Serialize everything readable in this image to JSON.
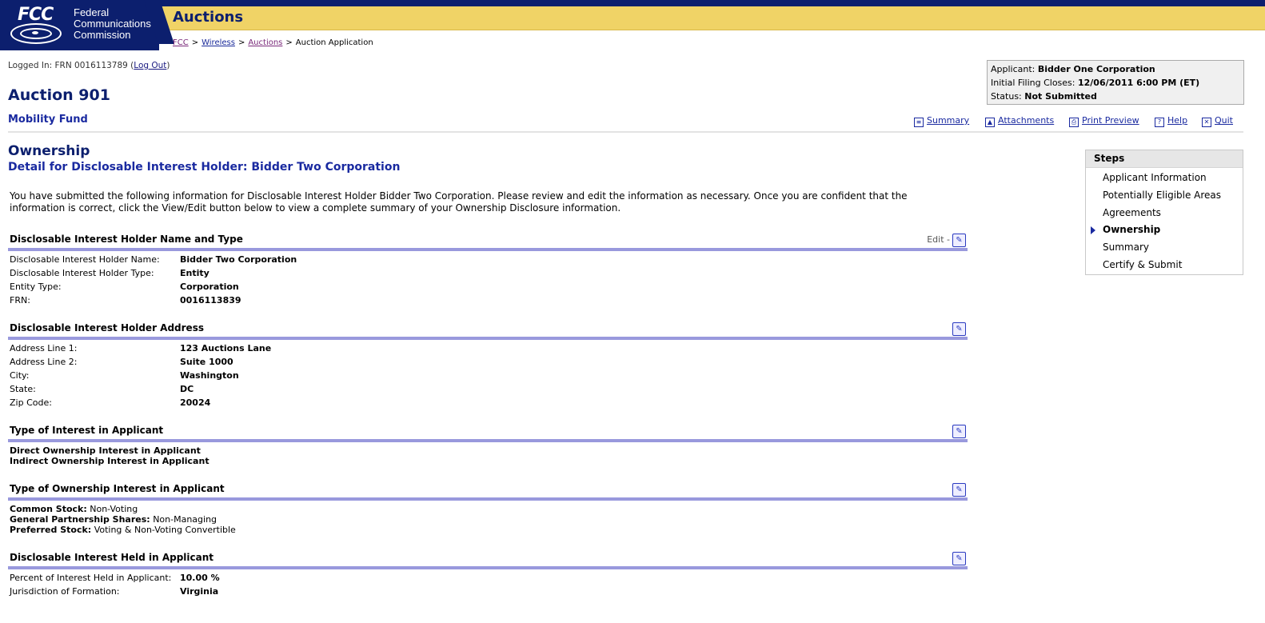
{
  "header": {
    "logo_text": "FCC",
    "agency_name": [
      "Federal",
      "Communications",
      "Commission"
    ],
    "app_title": "Auctions",
    "breadcrumb": [
      {
        "label": "FCC",
        "link": true
      },
      {
        "label": "Wireless",
        "link": true
      },
      {
        "label": "Auctions",
        "link": true
      },
      {
        "label": "Auction Application",
        "link": false
      }
    ]
  },
  "session": {
    "logged_in_prefix": "Logged In: FRN 0016113789 (",
    "logout_label": "Log Out",
    "logged_in_suffix": ")"
  },
  "auction": {
    "title": "Auction 901",
    "subtitle": "Mobility Fund"
  },
  "applicant_box": {
    "applicant_label": "Applicant:",
    "applicant_value": "Bidder One Corporation",
    "filing_label": "Initial Filing Closes:",
    "filing_value": "12/06/2011 6:00 PM (ET)",
    "status_label": "Status:",
    "status_value": "Not Submitted"
  },
  "toolbar": {
    "summary": "Summary",
    "attachments": "Attachments",
    "print_preview": "Print Preview",
    "help": "Help",
    "quit": "Quit"
  },
  "page": {
    "title": "Ownership",
    "subtitle": "Detail for Disclosable Interest Holder: Bidder Two Corporation",
    "intro": "You have submitted the following information for Disclosable Interest Holder Bidder Two Corporation. Please review and edit the information as necessary. Once you are confident that the information is correct, click the View/Edit button below to view a complete summary of your Ownership Disclosure information."
  },
  "sections": {
    "name_type": {
      "heading": "Disclosable Interest Holder Name and Type",
      "edit_label": "Edit -",
      "rows": [
        {
          "label": "Disclosable Interest Holder Name:",
          "value": "Bidder Two Corporation"
        },
        {
          "label": "Disclosable Interest Holder Type:",
          "value": "Entity"
        },
        {
          "label": "Entity Type:",
          "value": "Corporation"
        },
        {
          "label": "FRN:",
          "value": "0016113839"
        }
      ]
    },
    "address": {
      "heading": "Disclosable Interest Holder Address",
      "rows": [
        {
          "label": "Address Line 1:",
          "value": "123 Auctions Lane"
        },
        {
          "label": "Address Line 2:",
          "value": "Suite 1000"
        },
        {
          "label": "City:",
          "value": "Washington"
        },
        {
          "label": "State:",
          "value": "DC"
        },
        {
          "label": "Zip Code:",
          "value": "20024"
        }
      ]
    },
    "interest_type": {
      "heading": "Type of Interest in Applicant",
      "items": [
        "Direct Ownership Interest in Applicant",
        "Indirect Ownership Interest in Applicant"
      ]
    },
    "ownership_type": {
      "heading": "Type of Ownership Interest in Applicant",
      "items": [
        {
          "label": "Common Stock:",
          "value": "Non-Voting"
        },
        {
          "label": "General Partnership Shares:",
          "value": "Non-Managing"
        },
        {
          "label": "Preferred Stock:",
          "value": "Voting & Non-Voting Convertible"
        }
      ]
    },
    "interest_held": {
      "heading": "Disclosable Interest Held in Applicant",
      "rows": [
        {
          "label": "Percent of Interest Held in Applicant:",
          "value": "10.00 %"
        },
        {
          "label": "Jurisdiction of Formation:",
          "value": "Virginia"
        }
      ]
    }
  },
  "steps": {
    "title": "Steps",
    "items": [
      "Applicant Information",
      "Potentially Eligible Areas",
      "Agreements",
      "Ownership",
      "Summary",
      "Certify & Submit"
    ],
    "current": "Ownership"
  },
  "colors": {
    "navy": "#0c1f6e",
    "header_yellow": "#f0d366",
    "section_rule": "#9999dd",
    "link_blue": "#1a2aa0"
  }
}
